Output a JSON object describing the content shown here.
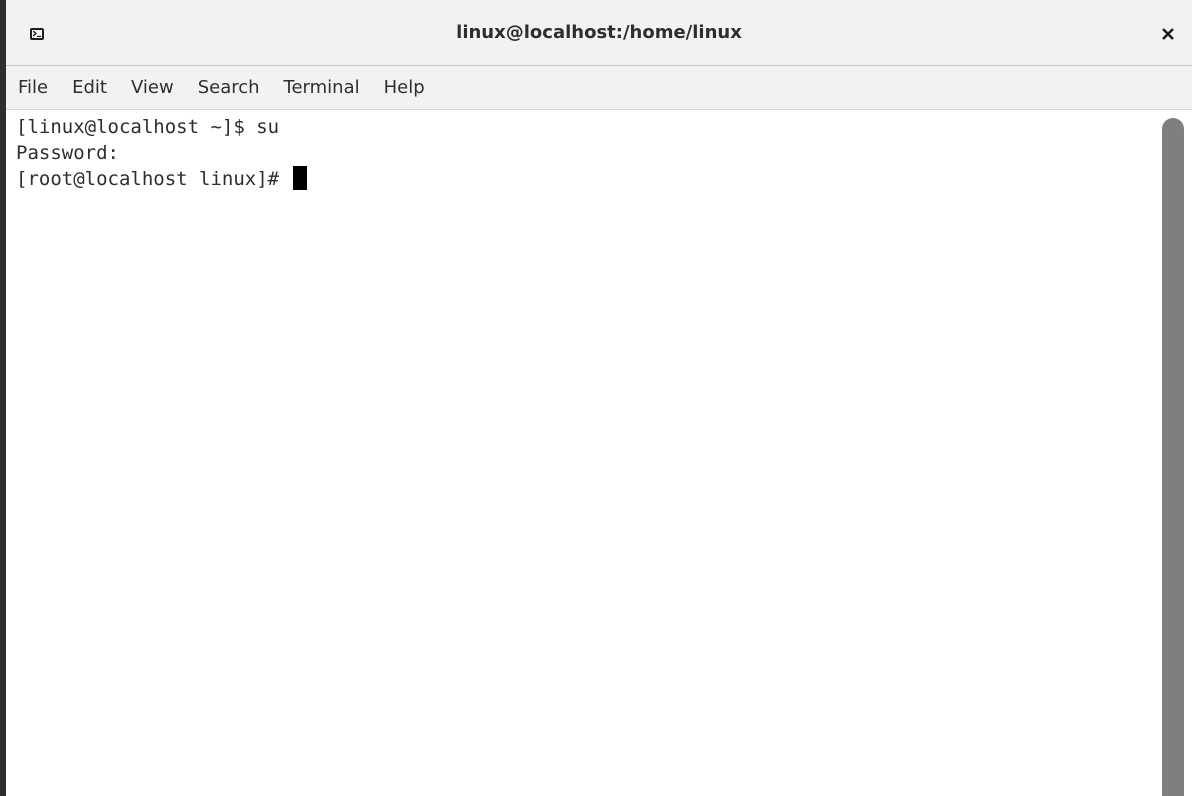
{
  "window": {
    "title": "linux@localhost:/home/linux",
    "app_icon": "terminal-icon",
    "close_icon": "close-icon"
  },
  "menubar": {
    "items": [
      "File",
      "Edit",
      "View",
      "Search",
      "Terminal",
      "Help"
    ]
  },
  "terminal": {
    "lines": [
      "[linux@localhost ~]$ su",
      "Password:",
      "[root@localhost linux]# "
    ]
  },
  "colors": {
    "background": "#ffffff",
    "chrome": "#f2f2f2",
    "text": "#2e2e2e",
    "cursor": "#000000",
    "scrollbar_thumb": "#7f7f7f"
  }
}
